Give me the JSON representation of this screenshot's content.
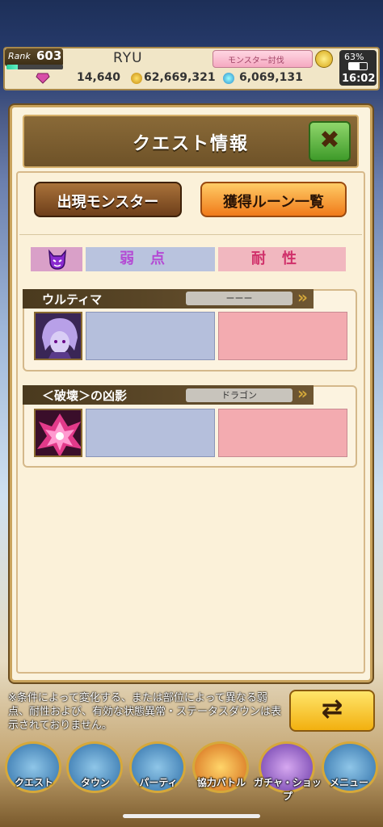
{
  "status_bar": {
    "rank_label": "Rank",
    "rank_value": "603",
    "exp_fraction": 0.2,
    "player_name": "RYU",
    "event_badge": "モンスター討伐",
    "gems": "14,640",
    "gold": "62,669,321",
    "points": "6,069,131",
    "battery_percent": "63%",
    "battery_fraction": 0.63,
    "clock": "16:02"
  },
  "dialog": {
    "title": "クエスト情報",
    "close_icon": "✖",
    "tabs": {
      "monsters": "出現モンスター",
      "runes": "獲得ルーン一覧"
    },
    "table_header": {
      "icon": "demon-icon",
      "weak": "弱点",
      "resist": "耐性"
    },
    "monsters": [
      {
        "name": "ウルティマ",
        "type": "ーーー",
        "weak": "",
        "resist": ""
      },
      {
        "name": "＜破壊＞の凶影",
        "type": "ドラゴン",
        "weak": "",
        "resist": ""
      }
    ]
  },
  "footnote": "※条件によって変化する、または部位によって異なる弱点、耐性および、有効な状態異常・ステータスダウンは表示されておりません。",
  "refresh_icon": "⇄",
  "bottom_nav": [
    {
      "label": "クエスト"
    },
    {
      "label": "タウン"
    },
    {
      "label": "パーティ"
    },
    {
      "label": "協力バトル"
    },
    {
      "label": "ガチャ・ショップ"
    },
    {
      "label": "メニュー"
    }
  ],
  "colors": {
    "weak_cell": "#b5bfdc",
    "resist_cell": "#f3abb0",
    "close_button": "#3f9b2a",
    "rune_tab": "#f07a1a"
  }
}
